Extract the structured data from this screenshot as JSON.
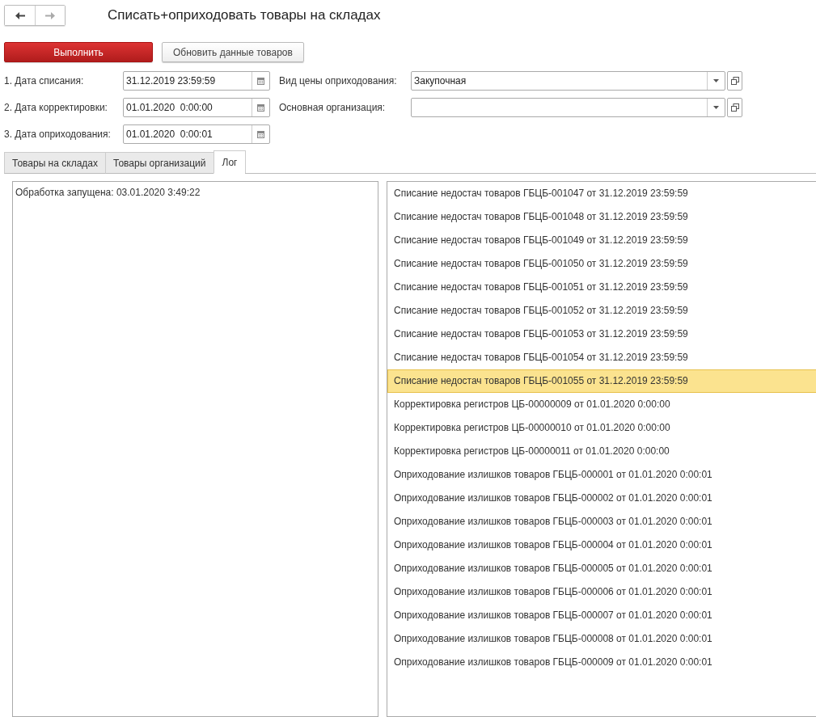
{
  "title": "Списать+оприходовать товары на складах",
  "buttons": [
    {
      "label": "Выполнить",
      "kind": "primary"
    },
    {
      "label": "Обновить данные товаров",
      "kind": "normal"
    }
  ],
  "date_fields": [
    {
      "label": "1. Дата списания:",
      "value": "31.12.2019 23:59:59"
    },
    {
      "label": "2. Дата корректировки:",
      "value": "01.01.2020  0:00:00"
    },
    {
      "label": "3. Дата оприходования:",
      "value": "01.01.2020  0:00:01"
    }
  ],
  "select_fields": [
    {
      "label": "Вид цены оприходования:",
      "value": "Закупочная"
    },
    {
      "label": "Основная организация:"
    }
  ],
  "tabs": [
    {
      "label": "Товары на складах",
      "selected": false
    },
    {
      "label": "Товары организаций",
      "selected": false
    },
    {
      "label": "Лог",
      "selected": true
    }
  ],
  "log_messages": [
    "Обработка запущена: 03.01.2020 3:49:22"
  ],
  "documents": [
    {
      "text": "Списание недостач товаров ГБЦБ-001047 от 31.12.2019 23:59:59",
      "selected": false
    },
    {
      "text": "Списание недостач товаров ГБЦБ-001048 от 31.12.2019 23:59:59",
      "selected": false
    },
    {
      "text": "Списание недостач товаров ГБЦБ-001049 от 31.12.2019 23:59:59",
      "selected": false
    },
    {
      "text": "Списание недостач товаров ГБЦБ-001050 от 31.12.2019 23:59:59",
      "selected": false
    },
    {
      "text": "Списание недостач товаров ГБЦБ-001051 от 31.12.2019 23:59:59",
      "selected": false
    },
    {
      "text": "Списание недостач товаров ГБЦБ-001052 от 31.12.2019 23:59:59",
      "selected": false
    },
    {
      "text": "Списание недостач товаров ГБЦБ-001053 от 31.12.2019 23:59:59",
      "selected": false
    },
    {
      "text": "Списание недостач товаров ГБЦБ-001054 от 31.12.2019 23:59:59",
      "selected": false
    },
    {
      "text": "Списание недостач товаров ГБЦБ-001055 от 31.12.2019 23:59:59",
      "selected": true
    },
    {
      "text": "Корректировка регистров ЦБ-00000009 от 01.01.2020 0:00:00",
      "selected": false
    },
    {
      "text": "Корректировка регистров ЦБ-00000010 от 01.01.2020 0:00:00",
      "selected": false
    },
    {
      "text": "Корректировка регистров ЦБ-00000011 от 01.01.2020 0:00:00",
      "selected": false
    },
    {
      "text": "Оприходование излишков товаров ГБЦБ-000001 от 01.01.2020 0:00:01",
      "selected": false
    },
    {
      "text": "Оприходование излишков товаров ГБЦБ-000002 от 01.01.2020 0:00:01",
      "selected": false
    },
    {
      "text": "Оприходование излишков товаров ГБЦБ-000003 от 01.01.2020 0:00:01",
      "selected": false
    },
    {
      "text": "Оприходование излишков товаров ГБЦБ-000004 от 01.01.2020 0:00:01",
      "selected": false
    },
    {
      "text": "Оприходование излишков товаров ГБЦБ-000005 от 01.01.2020 0:00:01",
      "selected": false
    },
    {
      "text": "Оприходование излишков товаров ГБЦБ-000006 от 01.01.2020 0:00:01",
      "selected": false
    },
    {
      "text": "Оприходование излишков товаров ГБЦБ-000007 от 01.01.2020 0:00:01",
      "selected": false
    },
    {
      "text": "Оприходование излишков товаров ГБЦБ-000008 от 01.01.2020 0:00:01",
      "selected": false
    },
    {
      "text": "Оприходование излишков товаров ГБЦБ-000009 от 01.01.2020 0:00:01",
      "selected": false
    }
  ]
}
